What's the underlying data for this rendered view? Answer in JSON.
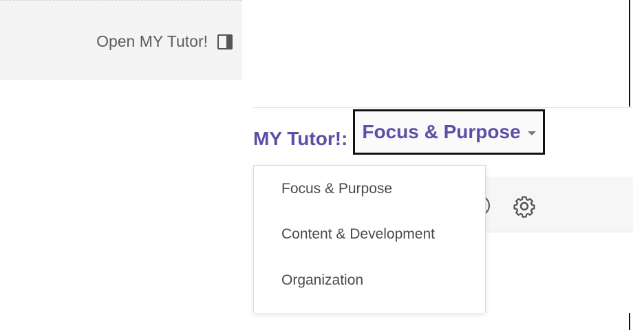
{
  "open_panel": {
    "label": "Open MY Tutor!",
    "icon": "panel-icon"
  },
  "header": {
    "tutor_label": "MY Tutor!:",
    "selected_topic": "Focus & Purpose"
  },
  "toolbar": {
    "icons": [
      "info-icon",
      "gear-icon"
    ]
  },
  "dropdown": {
    "items": [
      {
        "label": "Focus & Purpose"
      },
      {
        "label": "Content & Development"
      },
      {
        "label": "Organization"
      }
    ]
  },
  "colors": {
    "accent": "#5b4fa6",
    "panel_bg": "#f4f4f4",
    "text": "#4a4a4a"
  }
}
